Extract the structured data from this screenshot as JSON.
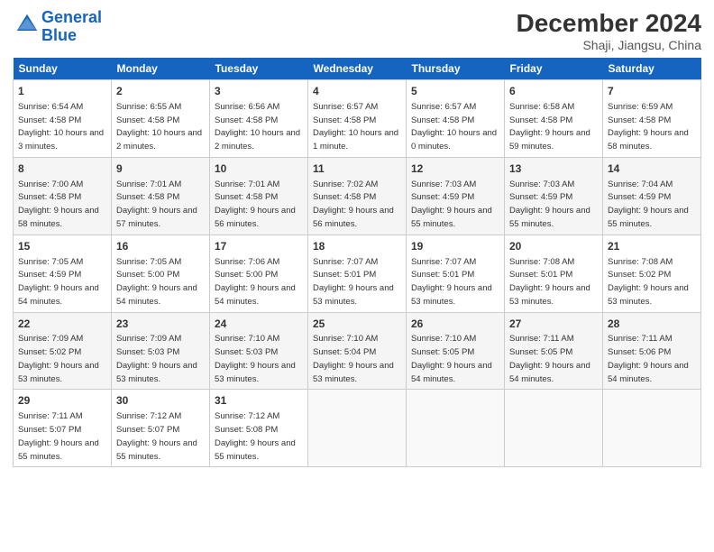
{
  "header": {
    "logo_line1": "General",
    "logo_line2": "Blue",
    "month": "December 2024",
    "location": "Shaji, Jiangsu, China"
  },
  "days_of_week": [
    "Sunday",
    "Monday",
    "Tuesday",
    "Wednesday",
    "Thursday",
    "Friday",
    "Saturday"
  ],
  "weeks": [
    [
      {
        "day": 1,
        "rise": "6:54 AM",
        "set": "4:58 PM",
        "hours": "10 hours and 3 minutes."
      },
      {
        "day": 2,
        "rise": "6:55 AM",
        "set": "4:58 PM",
        "hours": "10 hours and 2 minutes."
      },
      {
        "day": 3,
        "rise": "6:56 AM",
        "set": "4:58 PM",
        "hours": "10 hours and 2 minutes."
      },
      {
        "day": 4,
        "rise": "6:57 AM",
        "set": "4:58 PM",
        "hours": "10 hours and 1 minute."
      },
      {
        "day": 5,
        "rise": "6:57 AM",
        "set": "4:58 PM",
        "hours": "10 hours and 0 minutes."
      },
      {
        "day": 6,
        "rise": "6:58 AM",
        "set": "4:58 PM",
        "hours": "9 hours and 59 minutes."
      },
      {
        "day": 7,
        "rise": "6:59 AM",
        "set": "4:58 PM",
        "hours": "9 hours and 58 minutes."
      }
    ],
    [
      {
        "day": 8,
        "rise": "7:00 AM",
        "set": "4:58 PM",
        "hours": "9 hours and 58 minutes."
      },
      {
        "day": 9,
        "rise": "7:01 AM",
        "set": "4:58 PM",
        "hours": "9 hours and 57 minutes."
      },
      {
        "day": 10,
        "rise": "7:01 AM",
        "set": "4:58 PM",
        "hours": "9 hours and 56 minutes."
      },
      {
        "day": 11,
        "rise": "7:02 AM",
        "set": "4:58 PM",
        "hours": "9 hours and 56 minutes."
      },
      {
        "day": 12,
        "rise": "7:03 AM",
        "set": "4:59 PM",
        "hours": "9 hours and 55 minutes."
      },
      {
        "day": 13,
        "rise": "7:03 AM",
        "set": "4:59 PM",
        "hours": "9 hours and 55 minutes."
      },
      {
        "day": 14,
        "rise": "7:04 AM",
        "set": "4:59 PM",
        "hours": "9 hours and 55 minutes."
      }
    ],
    [
      {
        "day": 15,
        "rise": "7:05 AM",
        "set": "4:59 PM",
        "hours": "9 hours and 54 minutes."
      },
      {
        "day": 16,
        "rise": "7:05 AM",
        "set": "5:00 PM",
        "hours": "9 hours and 54 minutes."
      },
      {
        "day": 17,
        "rise": "7:06 AM",
        "set": "5:00 PM",
        "hours": "9 hours and 54 minutes."
      },
      {
        "day": 18,
        "rise": "7:07 AM",
        "set": "5:01 PM",
        "hours": "9 hours and 53 minutes."
      },
      {
        "day": 19,
        "rise": "7:07 AM",
        "set": "5:01 PM",
        "hours": "9 hours and 53 minutes."
      },
      {
        "day": 20,
        "rise": "7:08 AM",
        "set": "5:01 PM",
        "hours": "9 hours and 53 minutes."
      },
      {
        "day": 21,
        "rise": "7:08 AM",
        "set": "5:02 PM",
        "hours": "9 hours and 53 minutes."
      }
    ],
    [
      {
        "day": 22,
        "rise": "7:09 AM",
        "set": "5:02 PM",
        "hours": "9 hours and 53 minutes."
      },
      {
        "day": 23,
        "rise": "7:09 AM",
        "set": "5:03 PM",
        "hours": "9 hours and 53 minutes."
      },
      {
        "day": 24,
        "rise": "7:10 AM",
        "set": "5:03 PM",
        "hours": "9 hours and 53 minutes."
      },
      {
        "day": 25,
        "rise": "7:10 AM",
        "set": "5:04 PM",
        "hours": "9 hours and 53 minutes."
      },
      {
        "day": 26,
        "rise": "7:10 AM",
        "set": "5:05 PM",
        "hours": "9 hours and 54 minutes."
      },
      {
        "day": 27,
        "rise": "7:11 AM",
        "set": "5:05 PM",
        "hours": "9 hours and 54 minutes."
      },
      {
        "day": 28,
        "rise": "7:11 AM",
        "set": "5:06 PM",
        "hours": "9 hours and 54 minutes."
      }
    ],
    [
      {
        "day": 29,
        "rise": "7:11 AM",
        "set": "5:07 PM",
        "hours": "9 hours and 55 minutes."
      },
      {
        "day": 30,
        "rise": "7:12 AM",
        "set": "5:07 PM",
        "hours": "9 hours and 55 minutes."
      },
      {
        "day": 31,
        "rise": "7:12 AM",
        "set": "5:08 PM",
        "hours": "9 hours and 55 minutes."
      },
      null,
      null,
      null,
      null
    ]
  ]
}
